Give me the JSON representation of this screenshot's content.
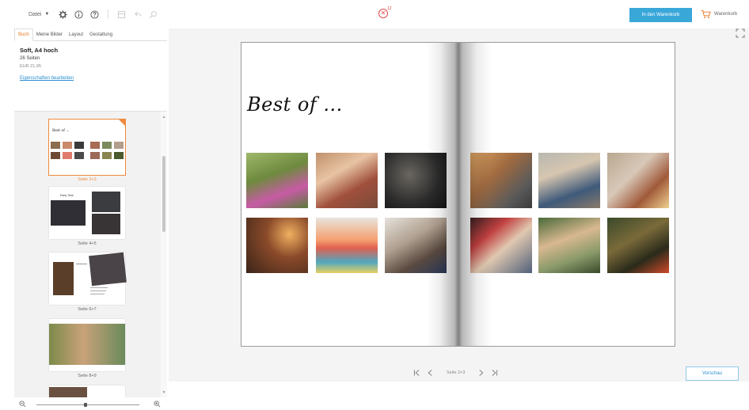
{
  "toolbar": {
    "file_menu": "Datei",
    "icons": [
      "settings-icon",
      "info-icon",
      "help-icon",
      "layers-icon",
      "undo-icon",
      "search-icon"
    ],
    "notification_count": "12",
    "add_to_cart": "In den Warenkorb",
    "cart_label": "Warenkorb",
    "colors": {
      "accent": "#3aa7d9",
      "notification": "#e04a4a"
    }
  },
  "sidebar": {
    "tabs": [
      {
        "label": "Buch",
        "active": true
      },
      {
        "label": "Meine Bilder",
        "active": false
      },
      {
        "label": "Layout",
        "active": false
      },
      {
        "label": "Gestaltung",
        "active": false
      }
    ],
    "book": {
      "title": "Soft, A4 hoch",
      "pages": "26 Seiten",
      "price": "EUR 21,95",
      "edit_link": "Eigenschaften bearbeiten"
    },
    "thumbnails": [
      {
        "label": "Seite 2+3",
        "mini_title": "Best of ...",
        "selected": true
      },
      {
        "label": "Seite 4+5",
        "mini_title": "Party Time",
        "selected": false
      },
      {
        "label": "Seite 6+7",
        "mini_title": "",
        "selected": false
      },
      {
        "label": "Seite 8+9",
        "mini_title": "",
        "selected": false
      }
    ],
    "selection_color": "#ef8a3d"
  },
  "canvas": {
    "page_title": "Best of ...",
    "page_indicator": "Seite 2+3",
    "preview_button": "Vorschau"
  }
}
